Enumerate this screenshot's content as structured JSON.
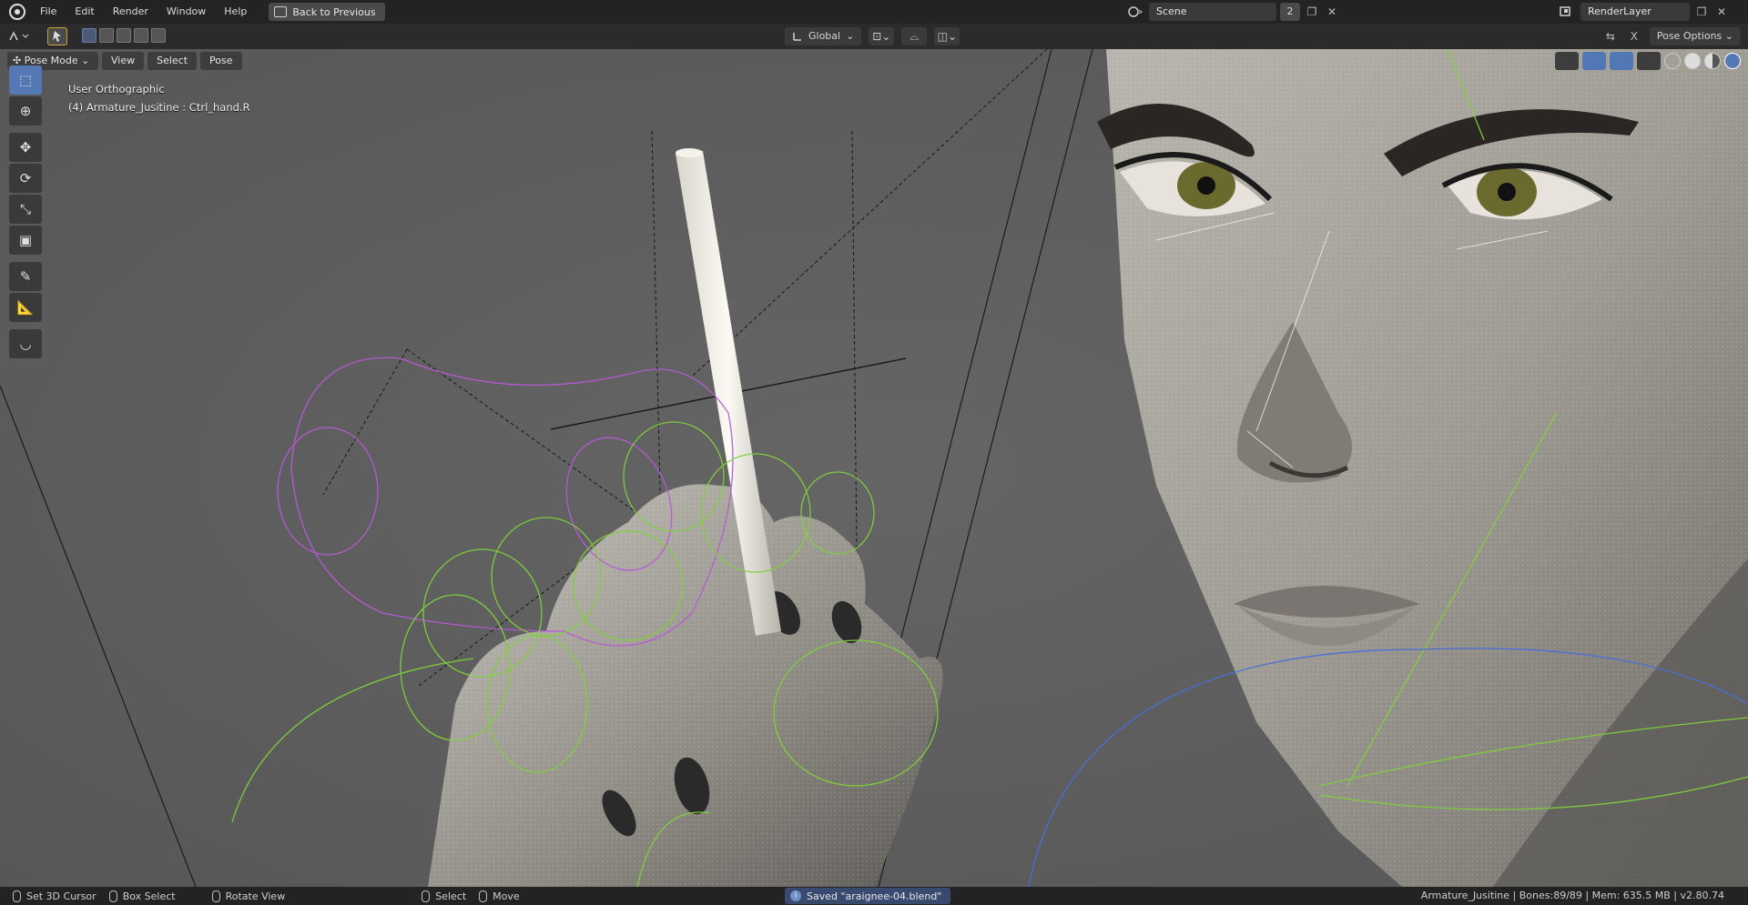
{
  "topbar": {
    "menus": [
      "File",
      "Edit",
      "Render",
      "Window",
      "Help"
    ],
    "back_button": "Back to Previous",
    "scene_name": "Scene",
    "scene_users": "2",
    "render_layer": "RenderLayer"
  },
  "header": {
    "orientation": "Global",
    "pose_options": "Pose Options"
  },
  "viewport": {
    "mode": "Pose Mode",
    "menus": [
      "View",
      "Select",
      "Pose"
    ],
    "view_name": "User Orthographic",
    "active_object": "(4) Armature_Jusitine : Ctrl_hand.R"
  },
  "toolbar": {
    "tools": [
      "select-box-icon",
      "cursor-icon",
      "move-icon",
      "rotate-icon",
      "scale-icon",
      "transform-icon",
      "annotate-icon",
      "measure-icon",
      "relax-icon"
    ]
  },
  "statusbar": {
    "hints": [
      "Set 3D Cursor",
      "Box Select",
      "Rotate View",
      "Select",
      "Move"
    ],
    "message": "Saved \"araignee-04.blend\"",
    "stats": "Armature_Jusitine | Bones:89/89 | Mem: 635.5 MB | v2.80.74"
  },
  "colors": {
    "accent": "#5478b4",
    "viewport_bg": "#5e5e5e",
    "bone_green": "#7fd13b",
    "bone_purple": "#b85ad6",
    "bone_blue": "#4a6fd8"
  }
}
